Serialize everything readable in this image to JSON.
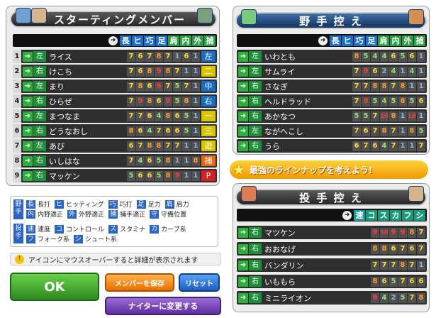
{
  "starting": {
    "title": "スターティングメンバー",
    "columns": [
      "長",
      "ヒ",
      "巧",
      "足",
      "肩",
      "内",
      "外",
      "捕"
    ],
    "players": [
      {
        "no": "1",
        "hand": "左",
        "name": "ライス",
        "vals": [
          "7",
          "6",
          "7",
          "8",
          "7",
          "1",
          "6",
          "1"
        ],
        "pos": "左",
        "pos_color": "#1a6ec0"
      },
      {
        "no": "2",
        "hand": "右",
        "name": "けこち",
        "vals": [
          "7",
          "6",
          "8",
          "9",
          "8",
          "7",
          "1",
          "1"
        ],
        "pos": "二",
        "pos_color": "#d9c400"
      },
      {
        "no": "3",
        "hand": "左",
        "name": "まり",
        "vals": [
          "7",
          "8",
          "6",
          "9",
          "7",
          "5",
          "7",
          "1"
        ],
        "pos": "中",
        "pos_color": "#1a6ec0"
      },
      {
        "no": "4",
        "hand": "右",
        "name": "ひらぜ",
        "vals": [
          "7",
          "9",
          "8",
          "6",
          "9",
          "5",
          "8",
          "1"
        ],
        "pos": "右",
        "pos_color": "#1a6ec0"
      },
      {
        "no": "5",
        "hand": "左",
        "name": "まつなま",
        "vals": [
          "7",
          "7",
          "6",
          "4",
          "8",
          "6",
          "5",
          "1"
        ],
        "pos": "一",
        "pos_color": "#d9c400"
      },
      {
        "no": "6",
        "hand": "右",
        "name": "どうなおし",
        "vals": [
          "8",
          "6",
          "4",
          "7",
          "6",
          "6",
          "5",
          "1"
        ],
        "pos": "三",
        "pos_color": "#d9c400"
      },
      {
        "no": "7",
        "hand": "左",
        "name": "あび",
        "vals": [
          "6",
          "7",
          "8",
          "8",
          "7",
          "7",
          "1",
          "1"
        ],
        "pos": "遊",
        "pos_color": "#d9c400"
      },
      {
        "no": "8",
        "hand": "右",
        "name": "いしはな",
        "vals": [
          "7",
          "4",
          "6",
          "5",
          "8",
          "1",
          "1",
          "8"
        ],
        "pos": "捕",
        "pos_color": "#e36a10"
      },
      {
        "no": "9",
        "hand": "右",
        "name": "マッケン",
        "vals": [
          "5",
          "6",
          "6",
          "5",
          "8",
          "9",
          "1",
          "1"
        ],
        "pos": "P",
        "pos_color": "#d42020"
      }
    ]
  },
  "bench_fielders": {
    "title": "野 手 控 え",
    "columns": [
      "長",
      "ヒ",
      "巧",
      "足",
      "肩",
      "内",
      "外",
      "捕"
    ],
    "players": [
      {
        "hand": "左",
        "name": "いわとも",
        "vals": [
          "8",
          "5",
          "4",
          "4",
          "6",
          "5",
          "6",
          "1"
        ]
      },
      {
        "hand": "左",
        "name": "サムライ",
        "vals": [
          "7",
          "9",
          "6",
          "2",
          "4",
          "1",
          "4",
          "1"
        ]
      },
      {
        "hand": "右",
        "name": "さなぎ",
        "vals": [
          "7",
          "7",
          "8",
          "8",
          "7",
          "8",
          "1",
          "1"
        ]
      },
      {
        "hand": "右",
        "name": "ヘルドラッド",
        "vals": [
          "7",
          "9",
          "5",
          "4",
          "5",
          "8",
          "5",
          "6"
        ]
      },
      {
        "hand": "右",
        "name": "あかなつ",
        "vals": [
          "5",
          "5",
          "7",
          "10",
          "8",
          "1",
          "10",
          "1"
        ]
      },
      {
        "hand": "左",
        "name": "ながへこし",
        "vals": [
          "7",
          "6",
          "7",
          "8",
          "7",
          "1",
          "8",
          "5"
        ]
      },
      {
        "hand": "右",
        "name": "うら",
        "vals": [
          "6",
          "7",
          "6",
          "4",
          "7",
          "1",
          "1",
          "7"
        ]
      }
    ]
  },
  "bench_pitchers": {
    "title": "投 手 控 え",
    "columns": [
      "速",
      "コ",
      "ス",
      "カ",
      "フ",
      "シ"
    ],
    "players": [
      {
        "hand": "右",
        "name": "マツケン",
        "vals": [
          "9",
          "10",
          "9",
          "9",
          "8",
          "7"
        ]
      },
      {
        "hand": "右",
        "name": "おおなげ",
        "vals": [
          "8",
          "8",
          "6",
          "7",
          "6",
          "7"
        ]
      },
      {
        "hand": "右",
        "name": "バンダリン",
        "vals": [
          "7",
          "7",
          "7",
          "8",
          "7",
          "1"
        ]
      },
      {
        "hand": "右",
        "name": "いももら",
        "vals": [
          "8",
          "6",
          "5",
          "7",
          "6",
          "6"
        ]
      },
      {
        "hand": "右",
        "name": "ミニライオン",
        "vals": [
          "9",
          "4",
          "2",
          "5",
          "7",
          "8"
        ]
      }
    ]
  },
  "banner": "最強のラインナップを考えよう!",
  "legend": {
    "fielder_side": "野手",
    "pitcher_side": "投手",
    "fielder_items": [
      {
        "k": "長",
        "v": "長打"
      },
      {
        "k": "ヒ",
        "v": "ヒッティング"
      },
      {
        "k": "巧",
        "v": "巧打"
      },
      {
        "k": "足",
        "v": "足力"
      },
      {
        "k": "肩",
        "v": "肩力"
      },
      {
        "k": "内",
        "v": "内野適正"
      },
      {
        "k": "外",
        "v": "外野適正"
      },
      {
        "k": "捕",
        "v": "捕手適正"
      },
      {
        "k": "守",
        "v": "守備位置"
      }
    ],
    "pitcher_items": [
      {
        "k": "速",
        "v": "速度"
      },
      {
        "k": "コ",
        "v": "コントロール"
      },
      {
        "k": "ス",
        "v": "スタミナ"
      },
      {
        "k": "カ",
        "v": "カーブ系"
      },
      {
        "k": "フ",
        "v": "フォーク系"
      },
      {
        "k": "シ",
        "v": "シュート系"
      }
    ]
  },
  "notice": "アイコンにマウスオーバーすると詳細が表示されます",
  "buttons": {
    "ok": "OK",
    "save": "メンバーを保存",
    "reset": "リセット",
    "night": "ナイターに変更する"
  }
}
